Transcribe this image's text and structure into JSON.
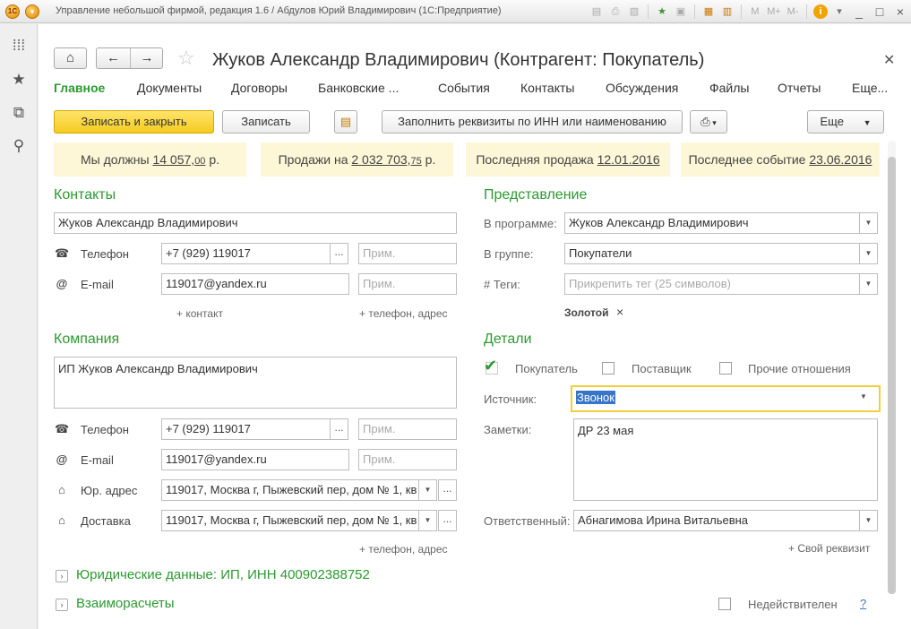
{
  "window": {
    "title": "Управление небольшой фирмой, редакция 1.6 / Абдулов Юрий Владимирович  (1С:Предприятие)",
    "logo_text": "1С",
    "menu_icon": "chevron-down-icon",
    "toolbar_icons": [
      "save-icon",
      "print-icon",
      "preview-icon",
      "favorite-icon",
      "history-icon",
      "calculator-icon",
      "calendar-icon",
      "memory-m-icon",
      "memory-mplus-icon",
      "memory-mminus-icon",
      "info-icon"
    ],
    "memory_labels": [
      "M",
      "M+",
      "M-"
    ],
    "win_controls": [
      "_",
      "□",
      "×"
    ]
  },
  "leftpanel": {
    "icons": [
      "apps-grid-icon",
      "favorites-star-icon",
      "history-icon",
      "search-icon"
    ]
  },
  "form": {
    "title": "Жуков Александр Владимирович (Контрагент: Покупатель)",
    "tabs": [
      "Главное",
      "Документы",
      "Договоры",
      "Банковские ...",
      "События",
      "Контакты",
      "Обсуждения",
      "Файлы",
      "Отчеты",
      "Еще..."
    ],
    "toolbar": {
      "save_close": "Записать и закрыть",
      "save": "Записать",
      "fill_inn": "Заполнить реквизиты по ИНН или наименованию",
      "more": "Еще"
    },
    "info": {
      "we_owe_label": "Мы должны",
      "we_owe_int": "14 057,",
      "we_owe_dec": "00",
      "we_owe_cur": " р.",
      "sales_label": "Продажи на",
      "sales_int": "2 032 703,",
      "sales_dec": "75",
      "sales_cur": " р.",
      "last_sale_label": "Последняя продажа",
      "last_sale_date": "12.01.2016",
      "last_event_label": "Последнее событие",
      "last_event_date": "23.06.2016"
    },
    "contacts": {
      "title": "Контакты",
      "name": "Жуков Александр Владимирович",
      "phone_label": "Телефон",
      "phone": "+7 (929) 119017",
      "email_label": "E-mail",
      "email": "119017@yandex.ru",
      "note_placeholder": "Прим.",
      "add_contact": "+ контакт",
      "add_phone_address": "+ телефон, адрес",
      "phone_icon": "phone-icon",
      "email_icon": "at-icon"
    },
    "company": {
      "title": "Компания",
      "name": "ИП Жуков Александр Владимирович",
      "phone_label": "Телефон",
      "phone": "+7 (929) 119017",
      "email_label": "E-mail",
      "email": "119017@yandex.ru",
      "legal_address_label": "Юр. адрес",
      "legal_address": "119017, Москва г, Пыжевский пер, дом № 1, кв",
      "delivery_label": "Доставка",
      "delivery_address": "119017, Москва г, Пыжевский пер, дом № 1, кв",
      "note_placeholder": "Прим.",
      "add_phone_address": "+ телефон, адрес",
      "home_icon": "home-icon"
    },
    "representation": {
      "title": "Представление",
      "in_program_label": "В программе:",
      "in_program": "Жуков Александр Владимирович",
      "group_label": "В группе:",
      "group": "Покупатели",
      "tags_label": "# Теги:",
      "tags_placeholder": "Прикрепить тег (25 символов)",
      "tag": "Золотой",
      "tag_remove": "×"
    },
    "details": {
      "title": "Детали",
      "buyer": "Покупатель",
      "supplier": "Поставщик",
      "other": "Прочие отношения",
      "source_label": "Источник:",
      "source": "Звонок",
      "notes_label": "Заметки:",
      "notes": "ДР 23 мая",
      "responsible_label": "Ответственный:",
      "responsible": "Абнагимова Ирина Витальевна",
      "own_attr": "+ Свой реквизит"
    },
    "legal": {
      "title": "Юридические данные: ИП, ИНН 400902388752"
    },
    "settlements": {
      "title": "Взаиморасчеты"
    },
    "invalid_label": "Недействителен",
    "help": "?"
  }
}
